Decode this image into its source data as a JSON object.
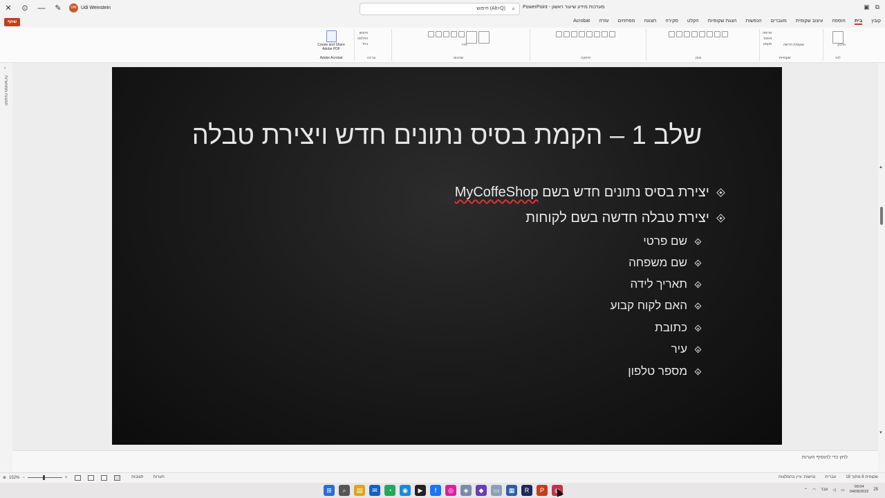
{
  "window": {
    "close_glyph": "✕",
    "autosave_glyph": "⊙",
    "minimize_glyph": "—",
    "pen_glyph": "✎",
    "user_name": "Udi Weinstein",
    "user_initials": "UW",
    "search_placeholder": "חיפוש (Alt+Q)",
    "app_name": "PowerPoint",
    "document_title": "מערכות מידע שיעור ראשון",
    "right_icons": [
      "▣",
      "⧉"
    ]
  },
  "share_label": "שתף",
  "tabs": [
    "קובץ",
    "בית",
    "הוספה",
    "עיצוב שקופית",
    "מעברים",
    "הנפשות",
    "הצגת שקופיות",
    "הקלט",
    "סקירה",
    "תצוגה",
    "מפתחים",
    "עזרה",
    "Acrobat"
  ],
  "active_tab": "בית",
  "ribbon": {
    "groups": [
      "לוח",
      "שקופיות",
      "גופן",
      "פיסקה",
      "שרטוט",
      "עריכה",
      "Adobe Acrobat"
    ],
    "adobe_button": "Create and Share Adobe PDF",
    "editing_items": [
      "חיפוש",
      "החלפה",
      "בחר"
    ],
    "slides_items": [
      "פריסה",
      "איפוס",
      "מקטע",
      "שקופית חדשה"
    ],
    "clipboard_items": [
      "הדבק"
    ],
    "drawing_items": [
      "סדר",
      "סגנונות מהירים"
    ]
  },
  "left_pane_label": "תמונות ממוזערות",
  "slide": {
    "title": "שלב 1 – הקמת בסיס נתונים חדש ויצירת טבלה",
    "bullet1_text": "יצירת בסיס נתונים חדש בשם ",
    "bullet1_name": "MyCoffeShop",
    "bullet2": "יצירת טבלה חדשה בשם לקוחות",
    "fields": [
      "שם פרטי",
      "שם משפחה",
      "תאריך לידה",
      "האם לקוח קבוע",
      "כתובת",
      "עיר",
      "מספר טלפון"
    ]
  },
  "notes_placeholder": "לחץ כדי להוסיף הערות",
  "status": {
    "slide_counter": "שקופית 8 מתוך 18",
    "language": "עברית",
    "accessibility": "נגישות: עיין בהמלצות",
    "notes_btn": "הערות",
    "comments_btn": "תגובות",
    "zoom": "152%"
  },
  "taskbar": {
    "apps": [
      "⊞",
      "⌕",
      "▤",
      "✉",
      "◔",
      "◉",
      "▶",
      "f",
      "◎",
      "◈",
      "◆",
      "▭",
      "▦",
      "R",
      "P",
      "◍"
    ],
    "lang": "עבר",
    "time": "09:04",
    "date": "04/09/2022",
    "notif_count": "25"
  },
  "colors": {
    "accent": "#c43e1c",
    "slide_bg": "#141414",
    "slide_text": "#e6e6e6"
  }
}
